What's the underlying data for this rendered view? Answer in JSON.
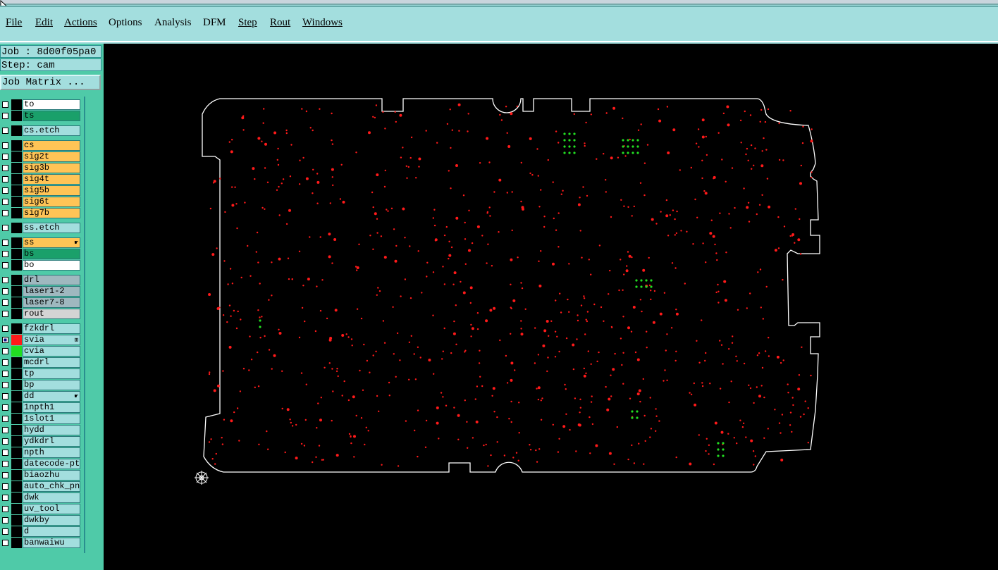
{
  "menu": [
    "File",
    "Edit",
    "Actions",
    "Options",
    "Analysis",
    "DFM",
    "Step",
    "Rout",
    "Windows"
  ],
  "info": {
    "job": "Job : 8d00f05pa0",
    "step": "Step: cam",
    "matrix_button": "Job Matrix ..."
  },
  "layers": [
    {
      "name": "to",
      "color": "#ffffff",
      "swatch": "#000000"
    },
    {
      "name": "ts",
      "color": "#1aa06a",
      "swatch": "#000000"
    },
    {
      "name": "cs.etch",
      "color": "#a3dede",
      "swatch": "#000000",
      "gap": true
    },
    {
      "name": "cs",
      "color": "#ffc456",
      "swatch": "#000000",
      "gap": true
    },
    {
      "name": "sig2t",
      "color": "#ffc456",
      "swatch": "#000000"
    },
    {
      "name": "sig3b",
      "color": "#ffc456",
      "swatch": "#000000"
    },
    {
      "name": "sig4t",
      "color": "#ffc456",
      "swatch": "#000000"
    },
    {
      "name": "sig5b",
      "color": "#ffc456",
      "swatch": "#000000"
    },
    {
      "name": "sig6t",
      "color": "#ffc456",
      "swatch": "#000000"
    },
    {
      "name": "sig7b",
      "color": "#ffc456",
      "swatch": "#000000"
    },
    {
      "name": "ss.etch",
      "color": "#a3dede",
      "swatch": "#000000",
      "gap": true
    },
    {
      "name": "ss",
      "color": "#ffc456",
      "swatch": "#000000",
      "gap": true,
      "mark": "hand"
    },
    {
      "name": "bs",
      "color": "#1aa06a",
      "swatch": "#000000"
    },
    {
      "name": "bo",
      "color": "#ffffff",
      "swatch": "#000000"
    },
    {
      "name": "drl",
      "color": "#9fb8bf",
      "swatch": "#000000",
      "gap": true
    },
    {
      "name": "laser1-2",
      "color": "#9fb8bf",
      "swatch": "#000000"
    },
    {
      "name": "laser7-8",
      "color": "#9fb8bf",
      "swatch": "#000000"
    },
    {
      "name": "rout",
      "color": "#d4d4d4",
      "swatch": "#000000"
    },
    {
      "name": "fzkdrl",
      "color": "#a3dede",
      "swatch": "#000000",
      "gap": true
    },
    {
      "name": "svia",
      "color": "#a3dede",
      "swatch": "#ff1a1a",
      "checked": true,
      "mark": "box"
    },
    {
      "name": "cvia",
      "color": "#a3dede",
      "swatch": "#22dd22"
    },
    {
      "name": "mcdrl",
      "color": "#a3dede",
      "swatch": "#000000"
    },
    {
      "name": "tp",
      "color": "#a3dede",
      "swatch": "#000000"
    },
    {
      "name": "bp",
      "color": "#a3dede",
      "swatch": "#000000"
    },
    {
      "name": "dd",
      "color": "#a3dede",
      "swatch": "#000000",
      "mark": "hand"
    },
    {
      "name": "1npth1",
      "color": "#a3dede",
      "swatch": "#000000"
    },
    {
      "name": "1slot1",
      "color": "#a3dede",
      "swatch": "#000000"
    },
    {
      "name": "hydd",
      "color": "#a3dede",
      "swatch": "#000000"
    },
    {
      "name": "ydkdrl",
      "color": "#a3dede",
      "swatch": "#000000"
    },
    {
      "name": "npth",
      "color": "#a3dede",
      "swatch": "#000000"
    },
    {
      "name": "datecode-pth",
      "color": "#a3dede",
      "swatch": "#000000"
    },
    {
      "name": "biaozhu",
      "color": "#a3dede",
      "swatch": "#000000"
    },
    {
      "name": "auto_chk_pnl",
      "color": "#a3dede",
      "swatch": "#000000"
    },
    {
      "name": "dwk",
      "color": "#a3dede",
      "swatch": "#000000"
    },
    {
      "name": "uv_tool",
      "color": "#a3dede",
      "swatch": "#000000"
    },
    {
      "name": "dwkby",
      "color": "#a3dede",
      "swatch": "#000000"
    },
    {
      "name": "d",
      "color": "#a3dede",
      "swatch": "#000000"
    },
    {
      "name": "banwaiwu",
      "color": "#a3dede",
      "swatch": "#000000"
    }
  ],
  "colors": {
    "canvas_bg": "#000000",
    "outline": "#ffffff",
    "svia": "#ff1a1a",
    "cvia": "#22dd22"
  }
}
